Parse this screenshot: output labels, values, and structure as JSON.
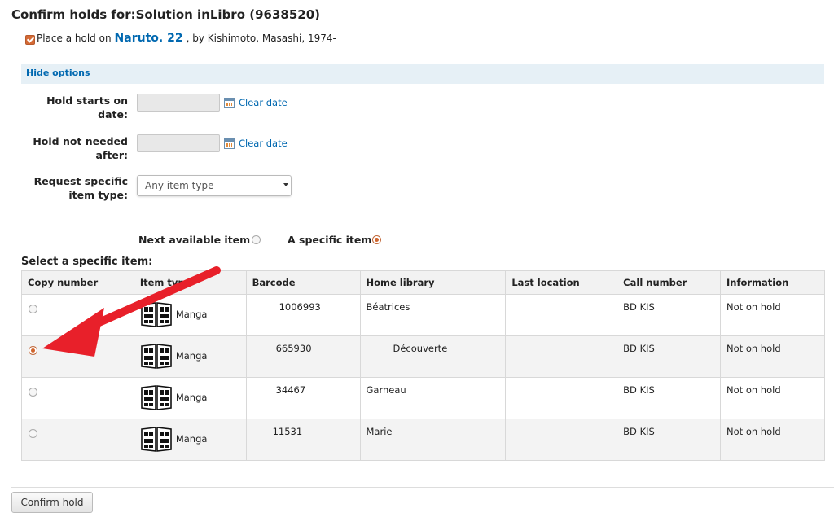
{
  "page": {
    "title": "Confirm holds for:Solution inLibro (9638520)",
    "place_prefix": "Place a hold on",
    "book_title": "Naruto. 22",
    "book_suffix": ", by Kishimoto, Masashi, 1974-",
    "hide_options": "Hide options"
  },
  "form": {
    "hold_starts_label": "Hold starts on date:",
    "hold_not_needed_label": "Hold not needed after:",
    "clear_date": "Clear date",
    "item_type_label": "Request specific item type:",
    "item_type_value": "Any item type",
    "next_available": "Next available item",
    "specific_item": "A specific item"
  },
  "items": {
    "heading": "Select a specific item:",
    "columns": [
      "Copy number",
      "Item type",
      "Barcode",
      "Home library",
      "Last location",
      "Call number",
      "Information"
    ],
    "rows": [
      {
        "item_type": "Manga",
        "barcode": "1006993",
        "home_library": "Béatrices",
        "last_location": "",
        "call_number": "BD KIS",
        "information": "Not on hold",
        "selected": false
      },
      {
        "item_type": "Manga",
        "barcode": "665930",
        "home_library": "Découverte",
        "last_location": "",
        "call_number": "BD KIS",
        "information": "Not on hold",
        "selected": true
      },
      {
        "item_type": "Manga",
        "barcode": "34467",
        "home_library": "Garneau",
        "last_location": "",
        "call_number": "BD KIS",
        "information": "Not on hold",
        "selected": false
      },
      {
        "item_type": "Manga",
        "barcode": "11531",
        "home_library": "Marie",
        "last_location": "",
        "call_number": "BD KIS",
        "information": "Not on hold",
        "selected": false
      }
    ]
  },
  "footer": {
    "confirm_label": "Confirm hold"
  },
  "colors": {
    "link": "#0068b0",
    "accent": "#d0642c",
    "annotation_arrow": "#e8202a"
  },
  "icons": {
    "item_type_icon": "manga-book-icon",
    "calendar": "calendar-icon"
  }
}
